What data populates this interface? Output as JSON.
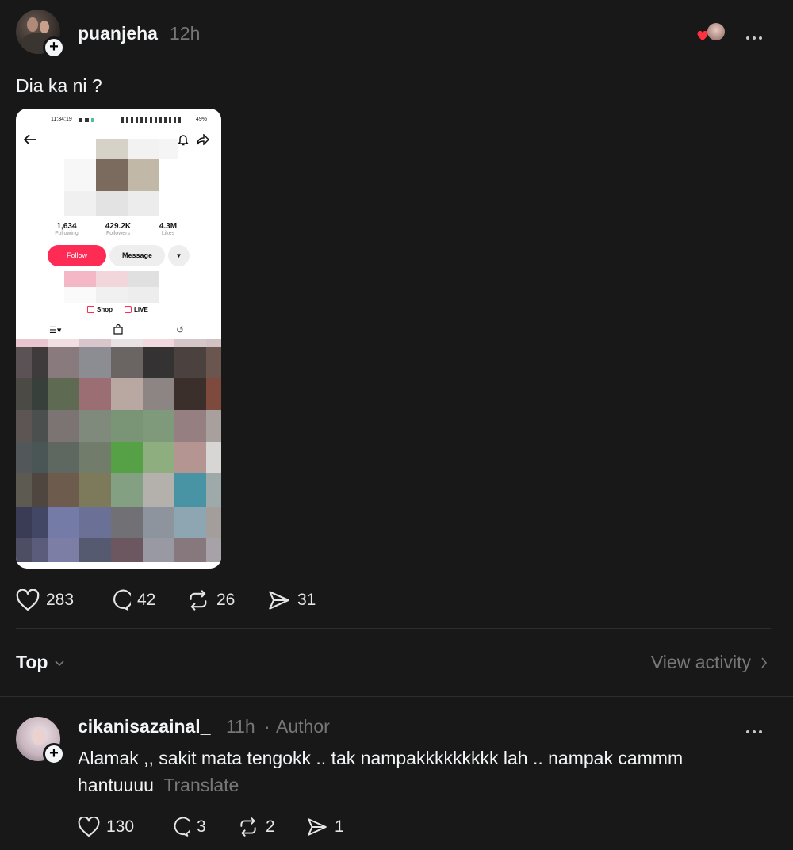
{
  "post": {
    "username": "puanjeha",
    "time": "12h",
    "text": "Dia ka ni ?",
    "actions": {
      "likes": "283",
      "replies": "42",
      "reposts": "26",
      "shares": "31"
    }
  },
  "screenshot": {
    "status_time": "11:34:19",
    "battery": "49%",
    "stats": [
      {
        "value": "1,634",
        "label": "Following"
      },
      {
        "value": "429.2K",
        "label": "Followers"
      },
      {
        "value": "4.3M",
        "label": "Likes"
      }
    ],
    "follow_label": "Follow",
    "message_label": "Message",
    "shop_label": "Shop",
    "live_label": "LIVE"
  },
  "sort": {
    "label": "Top",
    "view_activity": "View activity"
  },
  "reply": {
    "username": "cikanisazainal_",
    "time": "11h",
    "badge": "Author",
    "text": "Alamak ,, sakit mata tengokk .. tak nampakkkkkkkkk lah .. nampak cammm hantuuuu",
    "translate": "Translate",
    "actions": {
      "likes": "130",
      "replies": "3",
      "reposts": "2",
      "shares": "1"
    }
  },
  "colors": {
    "background": "#181818",
    "follow_button": "#fe2c55",
    "muted_text": "#777777"
  }
}
